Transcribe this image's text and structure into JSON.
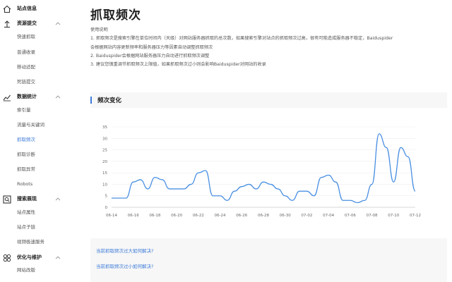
{
  "sidebar": {
    "site_info": "站点信息",
    "resource_submit": "资源提交",
    "resource_items": [
      "快速抓取",
      "普通收录",
      "移动适配",
      "死链提交"
    ],
    "data_stats": "数据统计",
    "data_items": [
      "索引量",
      "流量与关键词",
      "抓取频次",
      "抓取诊断",
      "抓取异常",
      "Robots"
    ],
    "search_display": "搜索展现",
    "search_items": [
      "站点属性",
      "站点子链",
      "视频极速服务"
    ],
    "optimize": "优化与维护",
    "optimize_items": [
      "网站改版"
    ]
  },
  "main": {
    "title": "抓取频次",
    "intro": [
      "使用说明",
      "1. 抓取频次是搜索引擎在单位时间内（天级）对网站服务器抓取的总次数，如果搜索引擎对站点的抓取频次过高，很有可能造成服务器不稳定，Baiduspider",
      "会根据网站内容更新频率和服务器压力等因素自动调整抓取频次",
      "2. Baiduspider会根据网站服务器压力自动进行抓取频次调整",
      "3. 建议您慎重调节抓取频次上限值，如果抓取频次过小则会影响Baiduspider对网站的收录"
    ],
    "panel_title": "频次变化",
    "links": [
      "当前抓取频次过大如何解决?",
      "当前抓取频次过小如何解决?"
    ]
  },
  "colors": {
    "accent": "#3d7bd9",
    "line": "#4a90e2"
  },
  "icons": [
    "home-icon",
    "upload-icon",
    "stats-icon",
    "search-display-icon",
    "settings-icon"
  ],
  "chart_data": {
    "type": "line",
    "yticks": [
      0,
      5,
      10,
      15,
      20,
      25,
      30,
      35
    ],
    "ylim": [
      0,
      35
    ],
    "xticks": [
      "06-14",
      "06-16",
      "06-18",
      "06-20",
      "06-22",
      "06-24",
      "06-26",
      "06-28",
      "06-30",
      "07-02",
      "07-04",
      "07-06",
      "07-08",
      "07-10",
      "07-12"
    ],
    "grid": true,
    "series": [
      {
        "values": [
          4,
          4,
          4,
          11,
          12,
          8,
          13,
          12,
          8,
          8,
          8,
          10,
          15,
          16,
          5,
          5,
          3,
          7,
          9,
          10,
          8,
          11,
          10,
          8,
          5,
          3,
          7,
          7,
          5,
          13,
          14,
          11,
          3,
          3,
          2,
          3,
          10,
          32,
          26,
          11,
          26,
          22,
          7
        ]
      }
    ]
  }
}
